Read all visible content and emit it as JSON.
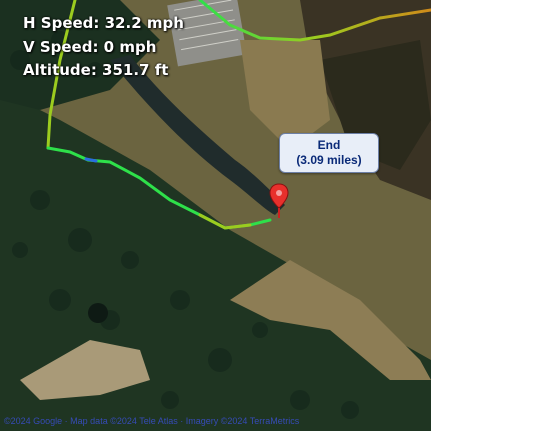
{
  "stats": {
    "h_speed": "H Speed: 32.2 mph",
    "v_speed": "V Speed: 0 mph",
    "altitude": "Altitude: 351.7 ft"
  },
  "end_marker": {
    "title": "End",
    "distance": "(3.09 miles)"
  },
  "attribution": "©2024 Google · Map data ©2024 Tele Atlas · Imagery ©2024 TerraMetrics",
  "colors": {
    "track_fast": "#2ee04a",
    "track_mid": "#9ccc1f",
    "track_slow": "#cf8a1a",
    "track_segment_blue": "#2a6de0",
    "marker_red": "#e8302c",
    "label_text": "#0a2a78"
  }
}
